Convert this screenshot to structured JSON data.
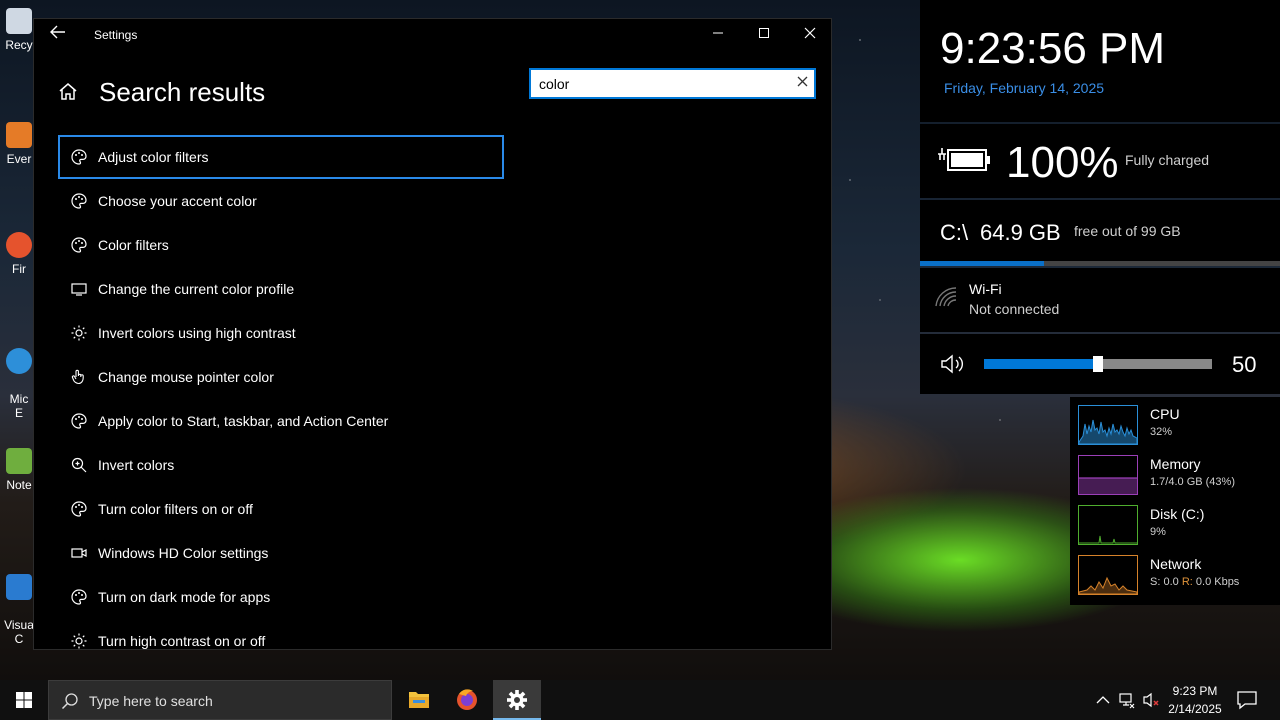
{
  "desktop": {
    "icons": [
      {
        "label": "Recy",
        "color": "#cfd8e3"
      },
      {
        "label": "Ever",
        "color": "#e57b27"
      },
      {
        "label": "Fir",
        "color": "#e5532d"
      },
      {
        "label": "Mic\nE",
        "color": "#2d8fd9"
      },
      {
        "label": "Note",
        "color": "#6fae3e"
      },
      {
        "label": "Visua\nC",
        "color": "#2a7bd0"
      }
    ]
  },
  "settings": {
    "window_title": "Settings",
    "page_title": "Search results",
    "search": {
      "value": "color"
    },
    "results": [
      {
        "label": "Adjust color filters",
        "icon": "palette-icon"
      },
      {
        "label": "Choose your accent color",
        "icon": "palette-icon"
      },
      {
        "label": "Color filters",
        "icon": "palette-icon"
      },
      {
        "label": "Change the current color profile",
        "icon": "monitor-icon"
      },
      {
        "label": "Invert colors using high contrast",
        "icon": "sun-icon"
      },
      {
        "label": "Change mouse pointer color",
        "icon": "hand-pointer-icon"
      },
      {
        "label": "Apply color to Start, taskbar, and Action Center",
        "icon": "palette-icon"
      },
      {
        "label": "Invert colors",
        "icon": "magnifier-icon"
      },
      {
        "label": "Turn color filters on or off",
        "icon": "palette-icon"
      },
      {
        "label": "Windows HD Color settings",
        "icon": "video-icon"
      },
      {
        "label": "Turn on dark mode for apps",
        "icon": "palette-icon"
      },
      {
        "label": "Turn high contrast on or off",
        "icon": "sun-icon"
      }
    ]
  },
  "widgets": {
    "time": "9:23:56 PM",
    "date": "Friday, February 14, 2025",
    "battery": {
      "percent": "100%",
      "status": "Fully charged"
    },
    "disk": {
      "drive": "C:\\",
      "free": "64.9 GB",
      "total": "free out of 99 GB",
      "used_fraction": 0.345
    },
    "wifi": {
      "name": "Wi-Fi",
      "status": "Not connected"
    },
    "volume": {
      "value": "50",
      "level": 0.5
    },
    "perf": [
      {
        "name": "CPU",
        "value": "32%",
        "color": "#2a8fd8"
      },
      {
        "name": "Memory",
        "value": "1.7/4.0 GB (43%)",
        "color": "#9b3fb8"
      },
      {
        "name": "Disk (C:)",
        "value": "9%",
        "color": "#4fae2e"
      },
      {
        "name": "Network",
        "value_s_label": "S:",
        "value_s": "0.0",
        "value_r_label": "R:",
        "value_r": "0.0 Kbps",
        "color": "#d6822a"
      }
    ]
  },
  "taskbar": {
    "search_placeholder": "Type here to search",
    "time": "9:23 PM",
    "date": "2/14/2025"
  }
}
